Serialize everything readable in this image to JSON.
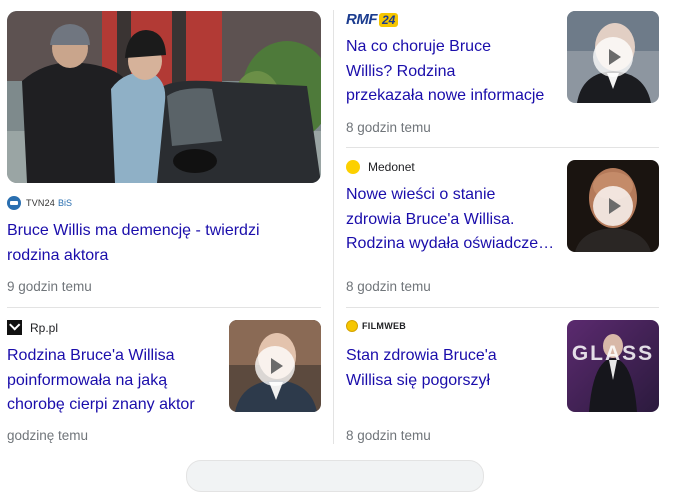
{
  "articles": [
    {
      "source": "TVN24 BiS",
      "source_main": "TVN24",
      "source_suffix": "BiS",
      "title_line1": "Bruce Willis ma demencję - twierdzi",
      "title_line2": "rodzina aktora",
      "time": "9 godzin temu",
      "has_video": false
    },
    {
      "source": "RMF 24",
      "source_main": "RMF",
      "source_suffix": "24",
      "title_line1": "Na co choruje Bruce",
      "title_line2": "Willis? Rodzina",
      "title_line3": "przekazała nowe informacje",
      "time": "8 godzin temu",
      "has_video": true
    },
    {
      "source": "Medonet",
      "title_line1": "Nowe wieści o stanie",
      "title_line2": "zdrowia Bruce'a Willisa.",
      "title_line3": "Rodzina wydała oświadcze…",
      "time": "8 godzin temu",
      "has_video": true
    },
    {
      "source": "Rp.pl",
      "title_line1": "Rodzina Bruce'a Willisa",
      "title_line2": "poinformowała na jaką",
      "title_line3": "chorobę cierpi znany aktor",
      "time": "godzinę temu",
      "has_video": true
    },
    {
      "source": "FILMWEB",
      "title_line1": "Stan zdrowia Bruce'a",
      "title_line2": "Willisa się pogorszył",
      "time": "8 godzin temu",
      "has_video": false
    }
  ],
  "glass_poster_text": "GLASS",
  "colors": {
    "link": "#1a0dab",
    "meta": "#70757a",
    "divider": "#e3e3e3",
    "rmf_blue": "#1b3c8f",
    "rmf_yellow": "#f6c600",
    "medonet_yellow": "#fcd000",
    "tvn_blue": "#2a6fb0"
  }
}
